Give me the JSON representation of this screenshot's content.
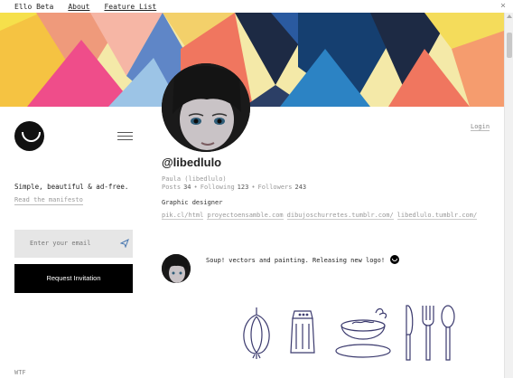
{
  "topbar": {
    "brand": "Ello Beta",
    "about": "About",
    "feature_list": "Feature List",
    "close": "×"
  },
  "sidebar": {
    "tagline": "Simple, beautiful & ad-free.",
    "manifesto_link": "Read the manifesto",
    "email_placeholder": "Enter your email",
    "request_button": "Request Invitation",
    "footer": "WTF"
  },
  "profile": {
    "login": "Login",
    "handle": "@libedlulo",
    "fullname": "Paula (libedlulo)",
    "posts_label": "Posts",
    "posts_count": "34",
    "following_label": "Following",
    "following_count": "123",
    "followers_label": "Followers",
    "followers_count": "243",
    "bio": "Graphic designer",
    "links": [
      "pik.cl/html",
      "proyectoensamble.com",
      "dibujoschurretes.tumblr.com/",
      "libedlulo.tumblr.com/"
    ]
  },
  "post": {
    "text": "Soup! vectors and painting. Releasing new logo!"
  },
  "colors": {
    "accent": "#000000",
    "banner_yellow": "#f6e04b",
    "banner_pink": "#ef4d8a",
    "banner_navy": "#1d2a44",
    "banner_coral": "#f0765f",
    "banner_blue": "#2c83c4"
  }
}
